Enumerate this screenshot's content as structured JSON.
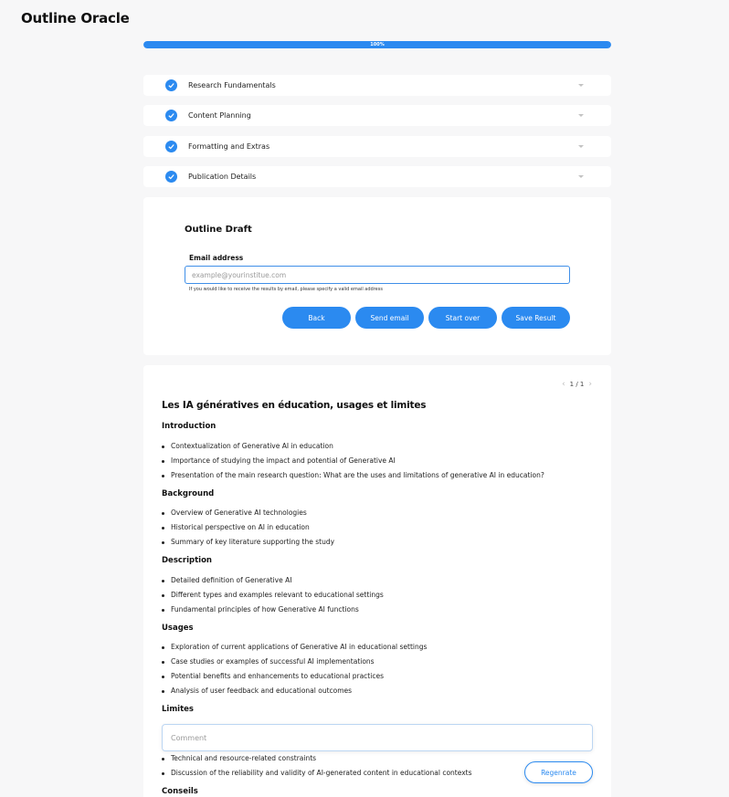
{
  "app": {
    "title": "Outline Oracle"
  },
  "progress": {
    "value": 100,
    "label": "100%"
  },
  "steps": [
    {
      "label": "Research Fundamentals",
      "completed": true
    },
    {
      "label": "Content Planning",
      "completed": true
    },
    {
      "label": "Formatting and Extras",
      "completed": true
    },
    {
      "label": "Publication Details",
      "completed": true
    }
  ],
  "draft": {
    "title": "Outline Draft",
    "email_label": "Email address",
    "email_placeholder": "example@yourinstitue.com",
    "email_value": "",
    "email_hint": "If you would like to receive the results by email, please specify a valid email address",
    "buttons": {
      "back": "Back",
      "send_email": "Send email",
      "start_over": "Start over",
      "save_result": "Save Result"
    }
  },
  "outline": {
    "pager": {
      "current": "1 / 1"
    },
    "title": "Les IA génératives en éducation, usages et limites",
    "sections": [
      {
        "heading": "Introduction",
        "items": [
          "Contextualization of Generative AI in education",
          "Importance of studying the impact and potential of Generative AI",
          "Presentation of the main research question: What are the uses and limitations of generative AI in education?"
        ]
      },
      {
        "heading": "Background",
        "items": [
          "Overview of Generative AI technologies",
          "Historical perspective on AI in education",
          "Summary of key literature supporting the study"
        ]
      },
      {
        "heading": "Description",
        "items": [
          "Detailed definition of Generative AI",
          "Different types and examples relevant to educational settings",
          "Fundamental principles of how Generative AI functions"
        ]
      },
      {
        "heading": "Usages",
        "items": [
          "Exploration of current applications of Generative AI in educational settings",
          "Case studies or examples of successful AI implementations",
          "Potential benefits and enhancements to educational practices",
          "Analysis of user feedback and educational outcomes"
        ]
      },
      {
        "heading": "Limites",
        "items": [
          "Technical and resource-related constraints",
          "Discussion of the reliability and validity of AI-generated content in educational contexts"
        ]
      },
      {
        "heading": "Conseils",
        "items": []
      }
    ]
  },
  "comment": {
    "placeholder": "Comment",
    "value": ""
  },
  "regenerate_label": "Regenrate",
  "colors": {
    "accent": "#2b8af0",
    "background": "#f7f7f8",
    "card": "#ffffff"
  },
  "icons": {
    "step_check": "check-circle-icon",
    "step_expand": "chevron-down-icon",
    "pager_prev": "chevron-left-icon",
    "pager_next": "chevron-right-icon"
  }
}
